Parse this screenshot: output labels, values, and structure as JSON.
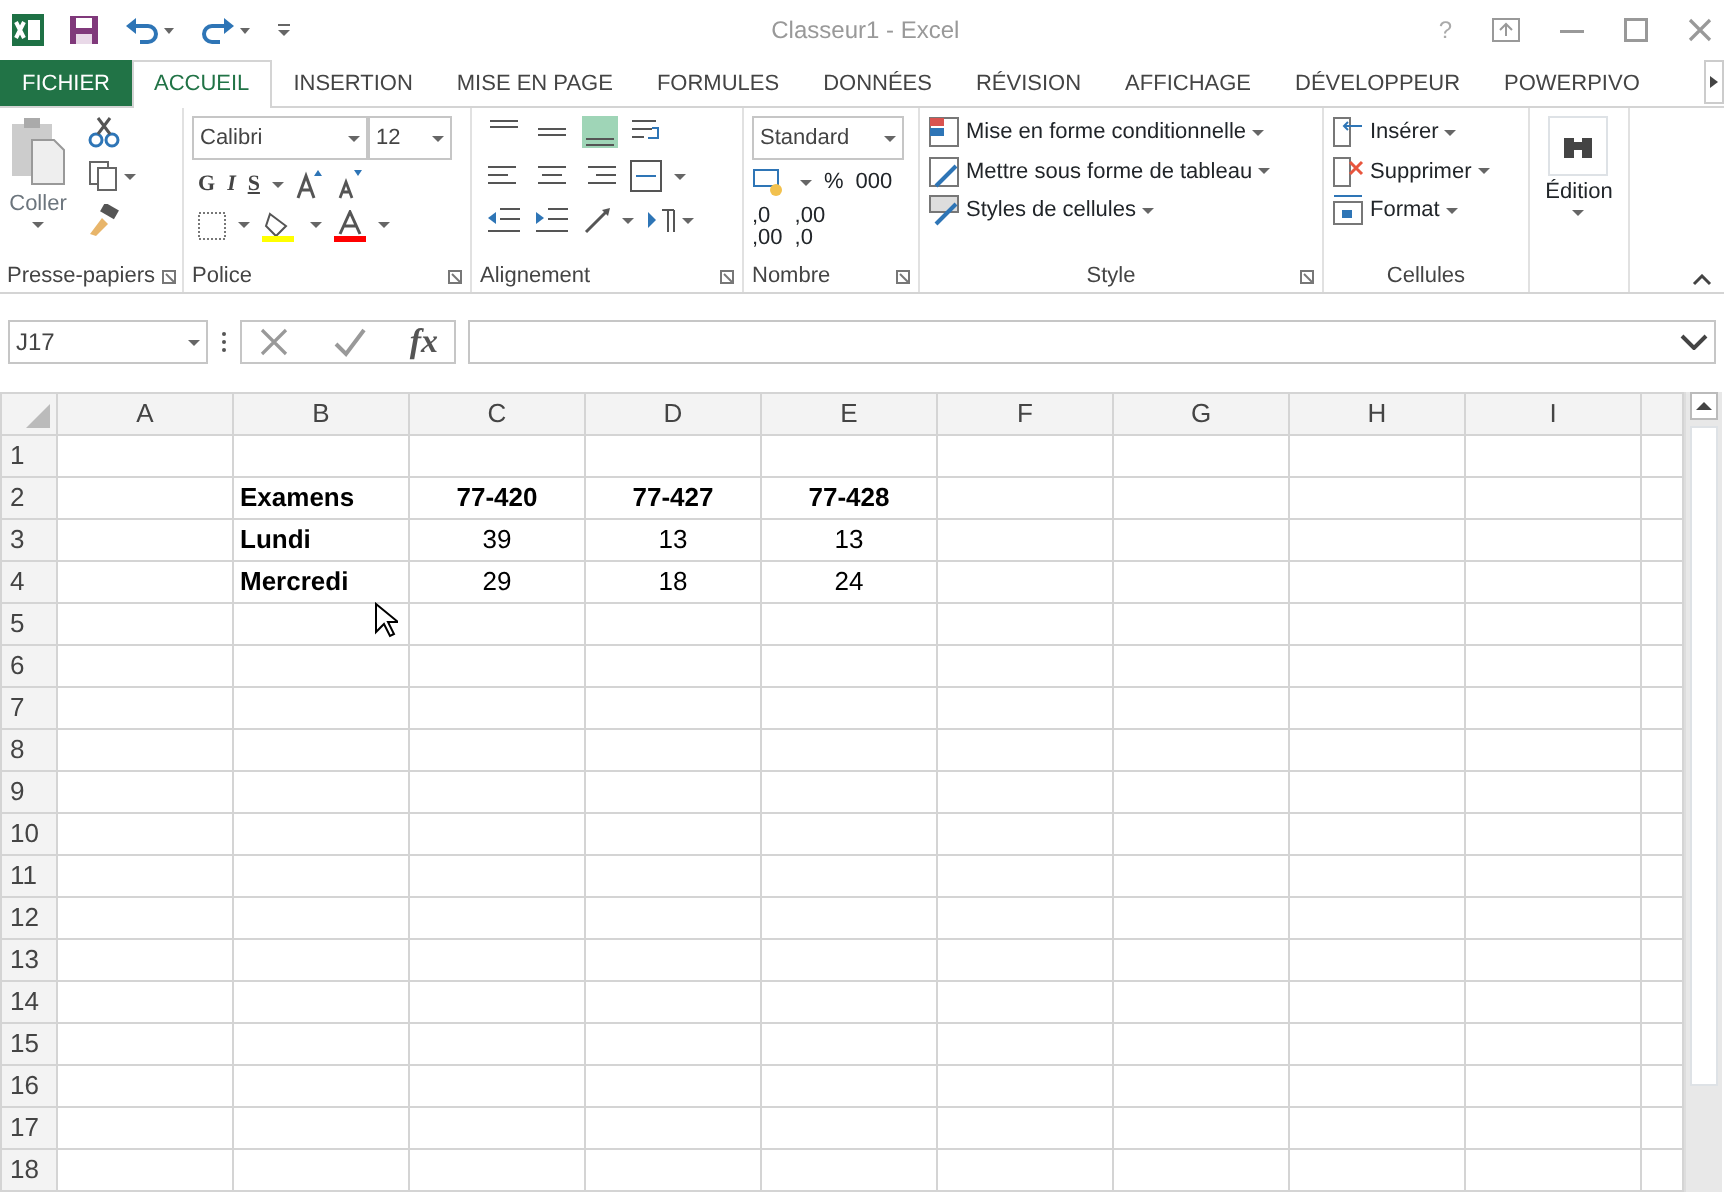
{
  "window": {
    "title": "Classeur1 - Excel",
    "help": "?"
  },
  "ribbon_tabs": [
    {
      "label": "FICHIER",
      "kind": "file",
      "selected": false
    },
    {
      "label": "ACCUEIL",
      "kind": "tab",
      "selected": true
    },
    {
      "label": "INSERTION",
      "kind": "tab",
      "selected": false
    },
    {
      "label": "MISE EN PAGE",
      "kind": "tab",
      "selected": false
    },
    {
      "label": "FORMULES",
      "kind": "tab",
      "selected": false
    },
    {
      "label": "DONNÉES",
      "kind": "tab",
      "selected": false
    },
    {
      "label": "RÉVISION",
      "kind": "tab",
      "selected": false
    },
    {
      "label": "AFFICHAGE",
      "kind": "tab",
      "selected": false
    },
    {
      "label": "DÉVELOPPEUR",
      "kind": "tab",
      "selected": false
    },
    {
      "label": "POWERPIVO",
      "kind": "tab",
      "selected": false
    }
  ],
  "clipboard": {
    "paste": "Coller",
    "label": "Presse-papiers"
  },
  "font": {
    "name": "Calibri",
    "size": "12",
    "bold": "G",
    "italic": "I",
    "underline": "S",
    "label": "Police"
  },
  "alignment": {
    "label": "Alignement"
  },
  "number": {
    "format": "Standard",
    "percent": "%",
    "thousands": "000",
    "decimals": [
      {
        "top": ",0",
        "bottom": ",00"
      },
      {
        "top": ",00",
        "bottom": ",0"
      }
    ],
    "label": "Nombre"
  },
  "style": {
    "items": [
      "Mise en forme conditionnelle",
      "Mettre sous forme de tableau",
      "Styles de cellules"
    ],
    "label": "Style"
  },
  "cells_group": {
    "items": [
      "Insérer",
      "Supprimer",
      "Format"
    ],
    "label": "Cellules"
  },
  "editing": {
    "label": "Édition"
  },
  "formula_bar": {
    "name_box": "J17",
    "fx": "fx"
  },
  "sheet": {
    "columns": [
      "A",
      "B",
      "C",
      "D",
      "E",
      "F",
      "G",
      "H",
      "I"
    ],
    "rows": [
      {
        "number": "1",
        "cells": [
          null,
          null,
          null,
          null,
          null
        ]
      },
      {
        "number": "2",
        "cells": [
          null,
          {
            "text": "Examens",
            "kind": "label"
          },
          {
            "text": "77-420",
            "kind": "heading"
          },
          {
            "text": "77-427",
            "kind": "heading"
          },
          {
            "text": "77-428",
            "kind": "heading"
          }
        ]
      },
      {
        "number": "3",
        "cells": [
          null,
          {
            "text": "Lundi",
            "kind": "label"
          },
          {
            "text": "39",
            "kind": "number"
          },
          {
            "text": "13",
            "kind": "number"
          },
          {
            "text": "13",
            "kind": "number"
          }
        ]
      },
      {
        "number": "4",
        "cells": [
          null,
          {
            "text": "Mercredi",
            "kind": "label"
          },
          {
            "text": "29",
            "kind": "number"
          },
          {
            "text": "18",
            "kind": "number"
          },
          {
            "text": "24",
            "kind": "number"
          }
        ]
      },
      {
        "number": "5",
        "cells": []
      },
      {
        "number": "6",
        "cells": []
      },
      {
        "number": "7",
        "cells": []
      },
      {
        "number": "8",
        "cells": []
      },
      {
        "number": "9",
        "cells": []
      },
      {
        "number": "10",
        "cells": []
      },
      {
        "number": "11",
        "cells": []
      },
      {
        "number": "12",
        "cells": []
      },
      {
        "number": "13",
        "cells": []
      },
      {
        "number": "14",
        "cells": []
      },
      {
        "number": "15",
        "cells": []
      },
      {
        "number": "16",
        "cells": []
      },
      {
        "number": "17",
        "cells": []
      },
      {
        "number": "18",
        "cells": []
      }
    ]
  }
}
